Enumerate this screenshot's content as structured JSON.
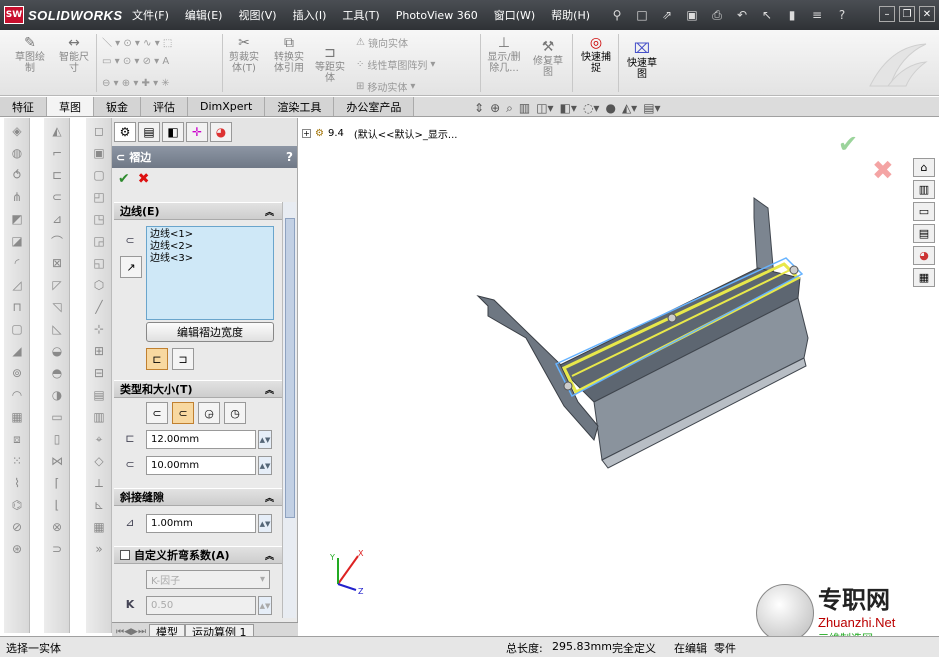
{
  "app": {
    "logo_text": "SW",
    "brand": "SOLIDWORKS"
  },
  "menu": [
    "文件(F)",
    "编辑(E)",
    "视图(V)",
    "插入(I)",
    "工具(T)",
    "PhotoView 360",
    "窗口(W)",
    "帮助(H)"
  ],
  "ribbon": {
    "sketch": "草图绘\n制",
    "smart_dimension": "智能尺\n寸",
    "trim": "剪裁实\n体(T)",
    "convert": "转换实\n体引用",
    "offset": "等距实\n体",
    "mirror": "镜向实体",
    "linear_pattern": "线性草图阵列",
    "move": "移动实体",
    "show_hide": "显示/删\n除几...",
    "repair": "修复草\n图",
    "quick_snaps": "快速捕\n捉",
    "rapid_sketch": "快速草\n图"
  },
  "tabs": [
    "特征",
    "草图",
    "钣金",
    "评估",
    "DimXpert",
    "渲染工具",
    "办公室产品"
  ],
  "active_tab": "草图",
  "pm": {
    "title": "褶边",
    "help": "?",
    "edges_group": "边线(E)",
    "edges": [
      "边线<1>",
      "边线<2>",
      "边线<3>"
    ],
    "edit_width": "编辑褶边宽度",
    "type_group": "类型和大小(T)",
    "length": "12.00mm",
    "gap": "10.00mm",
    "miter_group": "斜接缝隙",
    "miter_gap": "1.00mm",
    "custom_bend": "自定义折弯系数(A)",
    "bend_type": "K-因子",
    "k_label": "K",
    "k_value": "0.50"
  },
  "bottom_tabs": [
    "模型",
    "运动算例 1"
  ],
  "gfx": {
    "tree_label": "9.4",
    "tree_desc": "(默认<<默认>_显示..."
  },
  "status": {
    "left": "选择一实体",
    "length_label": "总长度:",
    "length_value": "295.83mm",
    "defined": "完全定义",
    "editing": "在编辑",
    "part": "零件"
  },
  "watermark": {
    "cn": "专职网",
    "url": "Zhuanzhi.Net",
    "sub": "三维制造网"
  }
}
